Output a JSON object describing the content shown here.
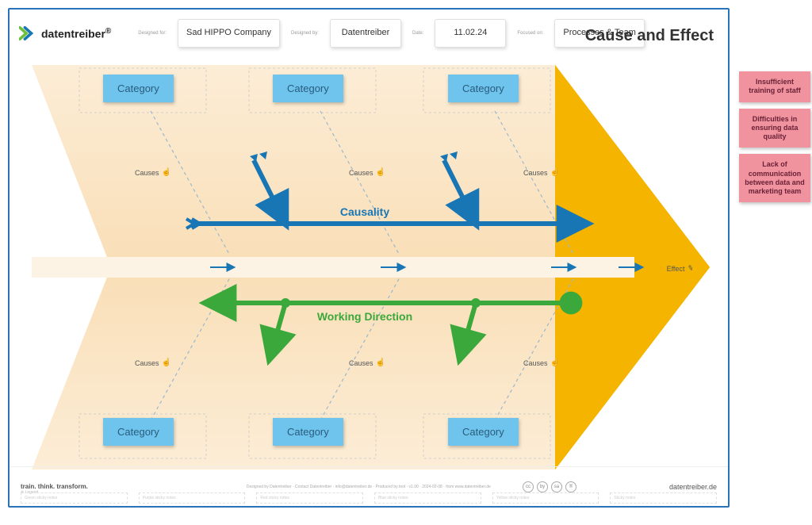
{
  "brand": "datentreiber",
  "header": {
    "label_designed_for": "Designed for:",
    "label_designed_by": "Designed by:",
    "label_date": "Date:",
    "label_focused": "Focused on:",
    "cards": {
      "designed_for": "Sad HIPPO Company",
      "designed_by": "Datentreiber",
      "date": "11.02.24",
      "focused_on": "Processes & Team"
    },
    "title": "Cause and Effect"
  },
  "fishbone": {
    "category_label": "Category",
    "causes_label": "Causes",
    "effect_label": "Effect",
    "causality_label": "Causality",
    "working_direction_label": "Working Direction"
  },
  "footer": {
    "tagline": "train. think. transform.",
    "fineprint": "Designed by Datentreiber · Contact Datentreiber · info@datentreiber.de · Produced by tool · v1.00 · 2024-02-08 · from www.datentreiber.de",
    "cc": [
      "cc",
      "by",
      "sa",
      "®"
    ],
    "website": "datentreiber.de",
    "bottom_slots": [
      "Green sticky notes",
      "Purple sticky notes",
      "Red sticky notes",
      "Blue sticky notes",
      "Yellow sticky notes",
      "Sticky notes"
    ],
    "legend_label": "Legend"
  },
  "side_notes": [
    "Insufficient training of staff",
    "Difficulties in ensuring data quality",
    "Lack of communication between data and marketing team"
  ],
  "colors": {
    "causality_blue": "#1976b5",
    "working_green": "#3aa83a",
    "effect_yellow": "#f4b400",
    "category_blue": "#6ec4ec",
    "note_pink": "#f1939f"
  }
}
